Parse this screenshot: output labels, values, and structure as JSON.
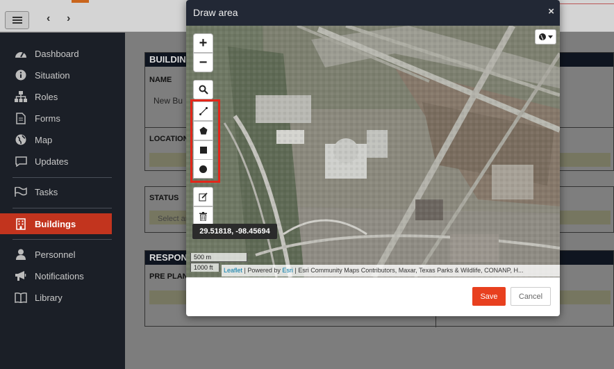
{
  "sidebar": {
    "items": [
      {
        "label": "Dashboard",
        "icon": "dashboard-icon"
      },
      {
        "label": "Situation",
        "icon": "info-icon"
      },
      {
        "label": "Roles",
        "icon": "sitemap-icon"
      },
      {
        "label": "Forms",
        "icon": "document-icon"
      },
      {
        "label": "Map",
        "icon": "globe-icon"
      },
      {
        "label": "Updates",
        "icon": "chat-icon"
      },
      {
        "label": "Tasks",
        "icon": "flag-icon"
      },
      {
        "label": "Buildings",
        "icon": "building-icon"
      },
      {
        "label": "Personnel",
        "icon": "person-icon"
      },
      {
        "label": "Notifications",
        "icon": "bullhorn-icon"
      },
      {
        "label": "Library",
        "icon": "book-icon"
      }
    ],
    "active": "Buildings"
  },
  "background": {
    "panel1_header": "BUILDIN",
    "name_label": "NAME",
    "name_value": "New Bu",
    "location_label": "LOCATION",
    "status_label": "STATUS",
    "status_placeholder": "Select ar",
    "response_header": "RESPON",
    "pre_plan_label": "PRE PLAN"
  },
  "modal": {
    "title": "Draw area",
    "close": "×",
    "map": {
      "zoom_in": "+",
      "zoom_out": "−",
      "coordinates": "29.51818, -98.45694",
      "scale_metric": "500 m",
      "scale_imperial": "1000 ft",
      "attribution": {
        "leaflet": "Leaflet",
        "powered_by": " | Powered by ",
        "esri": "Esri",
        "rest": " | Esri Community Maps Contributors, Maxar, Texas Parks & Wildlife, CONANP, H..."
      },
      "tools": [
        "search-icon",
        "polyline-icon",
        "polygon-icon",
        "rectangle-icon",
        "circle-icon",
        "edit-icon",
        "trash-icon"
      ]
    },
    "save_label": "Save",
    "cancel_label": "Cancel"
  }
}
